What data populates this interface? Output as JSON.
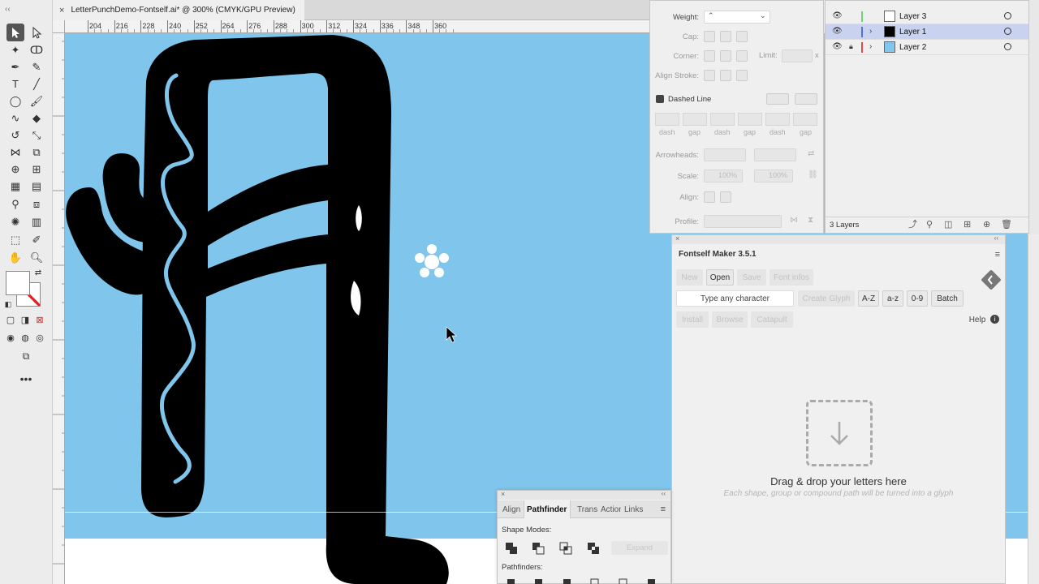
{
  "document": {
    "tab_title": "LetterPunchDemo-Fontself.ai* @ 300% (CMYK/GPU Preview)",
    "close_glyph": "×"
  },
  "ruler": {
    "labels": [
      "204",
      "216",
      "228",
      "240",
      "252",
      "264",
      "276",
      "288",
      "300",
      "312",
      "324",
      "336",
      "348",
      "360"
    ]
  },
  "stroke_panel": {
    "weight_label": "Weight:",
    "cap_label": "Cap:",
    "corner_label": "Corner:",
    "limit_label": "Limit:",
    "limit_x": "x",
    "align_stroke_label": "Align Stroke:",
    "dashed_line_label": "Dashed Line",
    "dash_labels": [
      "dash",
      "gap",
      "dash",
      "gap",
      "dash",
      "gap"
    ],
    "arrowheads_label": "Arrowheads:",
    "scale_label": "Scale:",
    "scale_values": [
      "100%",
      "100%"
    ],
    "align_label": "Align:",
    "profile_label": "Profile:"
  },
  "layers_panel": {
    "layers": [
      {
        "name": "Layer 3",
        "color": "#6fd36f",
        "selected": false,
        "locked": false
      },
      {
        "name": "Layer 1",
        "color": "#4f6fe8",
        "selected": true,
        "locked": false
      },
      {
        "name": "Layer 2",
        "color": "#e24a4a",
        "selected": false,
        "locked": true
      }
    ],
    "count_label": "3 Layers"
  },
  "fontself": {
    "title": "Fontself Maker 3.5.1",
    "buttons_row1": [
      "New",
      "Open",
      "Save",
      "Font infos"
    ],
    "input_placeholder": "Type any character",
    "buttons_row2": [
      "Create Glyph",
      "A-Z",
      "a-z",
      "0-9",
      "Batch"
    ],
    "help_label": "Help",
    "buttons_row3": [
      "Install",
      "Browse",
      "Catapult"
    ],
    "drop_main": "Drag & drop your letters here",
    "drop_sub": "Each shape, group or compound path will be turned into a glyph"
  },
  "pathfinder": {
    "tabs": [
      "Align",
      "Pathfinder",
      "Transform",
      "Actions",
      "Links"
    ],
    "active_tab": "Pathfinder",
    "shape_modes_label": "Shape Modes:",
    "expand_label": "Expand",
    "pathfinders_label": "Pathfinders:"
  },
  "colors": {
    "artboard_blue": "#7fc5ec",
    "selection_row": "#c9d2ee",
    "glyph_black": "#000000"
  }
}
